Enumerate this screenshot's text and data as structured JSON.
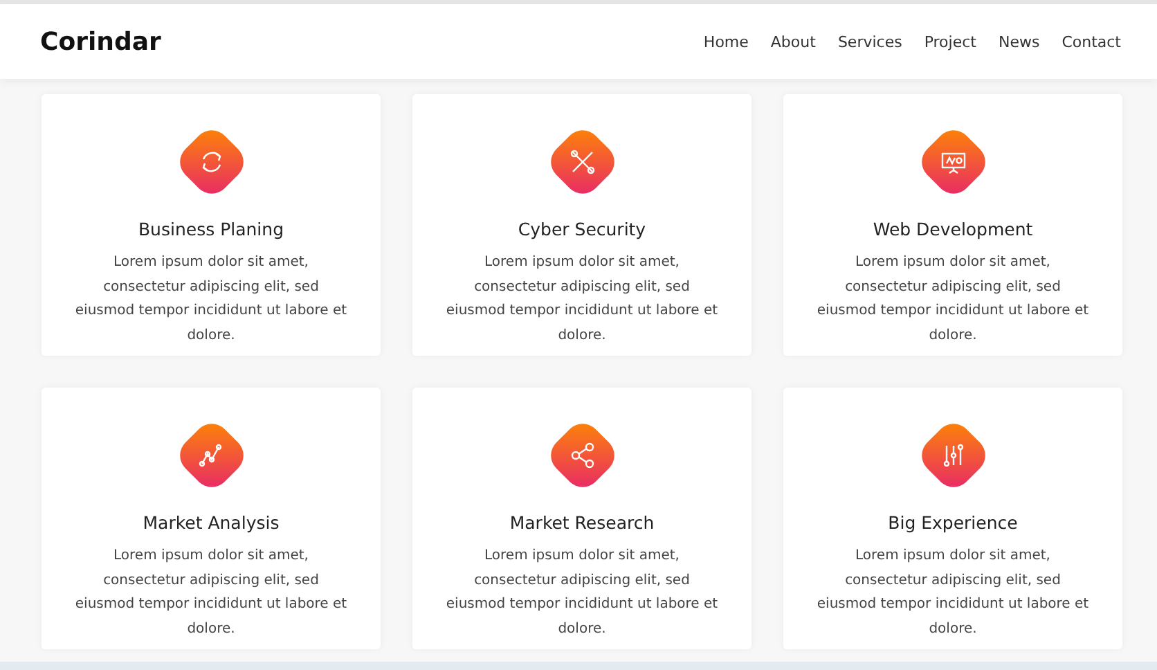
{
  "brand": "Corindar",
  "nav": [
    "Home",
    "About",
    "Services",
    "Project",
    "News",
    "Contact"
  ],
  "services": [
    {
      "title": "Business Planing",
      "text": "Lorem ipsum dolor sit amet, consectetur adipiscing elit, sed eiusmod tempor incididunt ut labore et dolore."
    },
    {
      "title": "Cyber Security",
      "text": "Lorem ipsum dolor sit amet, consectetur adipiscing elit, sed eiusmod tempor incididunt ut labore et dolore."
    },
    {
      "title": "Web Development",
      "text": "Lorem ipsum dolor sit amet, consectetur adipiscing elit, sed eiusmod tempor incididunt ut labore et dolore."
    },
    {
      "title": "Market Analysis",
      "text": "Lorem ipsum dolor sit amet, consectetur adipiscing elit, sed eiusmod tempor incididunt ut labore et dolore."
    },
    {
      "title": "Market Research",
      "text": "Lorem ipsum dolor sit amet, consectetur adipiscing elit, sed eiusmod tempor incididunt ut labore et dolore."
    },
    {
      "title": "Big Experience",
      "text": "Lorem ipsum dolor sit amet, consectetur adipiscing elit, sed eiusmod tempor incididunt ut labore et dolore."
    }
  ]
}
